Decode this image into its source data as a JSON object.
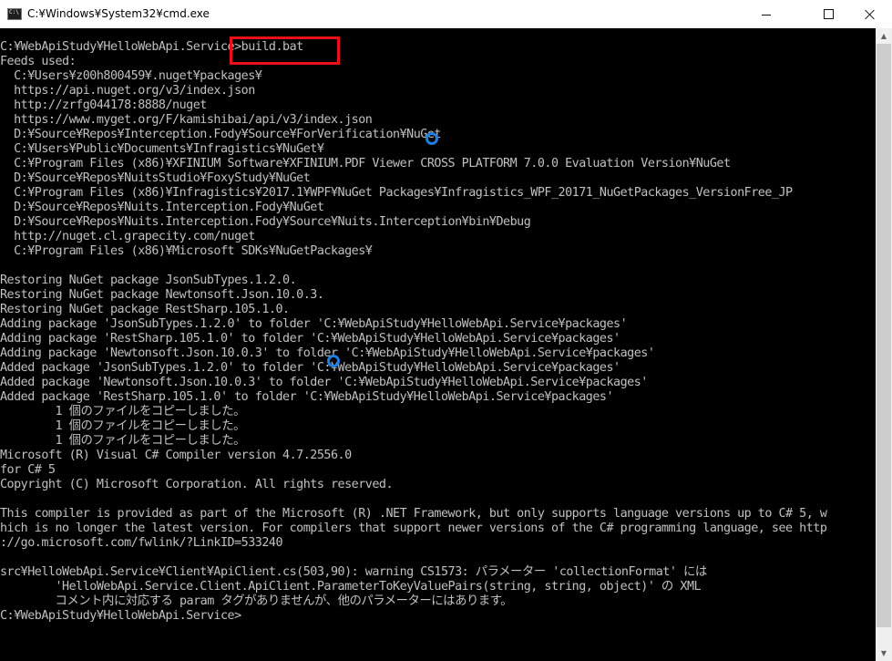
{
  "window": {
    "title": "C:¥Windows¥System32¥cmd.exe",
    "icons": {
      "app": "cmd-icon",
      "minimize": "minimize-icon",
      "maximize": "maximize-icon",
      "close": "close-icon",
      "scroll_up": "scroll-up-arrow-icon",
      "scroll_down": "scroll-down-arrow-icon"
    }
  },
  "console": {
    "lines": [
      "C:¥WebApiStudy¥HelloWebApi.Service>build.bat",
      "Feeds used:",
      "  C:¥Users¥z00h800459¥.nuget¥packages¥",
      "  https://api.nuget.org/v3/index.json",
      "  http://zrfg044178:8888/nuget",
      "  https://www.myget.org/F/kamishibai/api/v3/index.json",
      "  D:¥Source¥Repos¥Interception.Fody¥Source¥ForVerification¥NuGet",
      "  C:¥Users¥Public¥Documents¥Infragistics¥NuGet¥",
      "  C:¥Program Files (x86)¥XFINIUM Software¥XFINIUM.PDF Viewer CROSS PLATFORM 7.0.0 Evaluation Version¥NuGet",
      "  D:¥Source¥Repos¥NuitsStudio¥FoxyStudy¥NuGet",
      "  C:¥Program Files (x86)¥Infragistics¥2017.1¥WPF¥NuGet Packages¥Infragistics_WPF_20171_NuGetPackages_VersionFree_JP",
      "  D:¥Source¥Repos¥Nuits.Interception.Fody¥NuGet",
      "  D:¥Source¥Repos¥Nuits.Interception.Fody¥Source¥Nuits.Interception¥bin¥Debug",
      "  http://nuget.cl.grapecity.com/nuget",
      "  C:¥Program Files (x86)¥Microsoft SDKs¥NuGetPackages¥",
      "",
      "Restoring NuGet package JsonSubTypes.1.2.0.",
      "Restoring NuGet package Newtonsoft.Json.10.0.3.",
      "Restoring NuGet package RestSharp.105.1.0.",
      "Adding package 'JsonSubTypes.1.2.0' to folder 'C:¥WebApiStudy¥HelloWebApi.Service¥packages'",
      "Adding package 'RestSharp.105.1.0' to folder 'C:¥WebApiStudy¥HelloWebApi.Service¥packages'",
      "Adding package 'Newtonsoft.Json.10.0.3' to folder 'C:¥WebApiStudy¥HelloWebApi.Service¥packages'",
      "Added package 'JsonSubTypes.1.2.0' to folder 'C:¥WebApiStudy¥HelloWebApi.Service¥packages'",
      "Added package 'Newtonsoft.Json.10.0.3' to folder 'C:¥WebApiStudy¥HelloWebApi.Service¥packages'",
      "Added package 'RestSharp.105.1.0' to folder 'C:¥WebApiStudy¥HelloWebApi.Service¥packages'",
      "        1 個のファイルをコピーしました。",
      "        1 個のファイルをコピーしました。",
      "        1 個のファイルをコピーしました。",
      "Microsoft (R) Visual C# Compiler version 4.7.2556.0",
      "for C# 5",
      "Copyright (C) Microsoft Corporation. All rights reserved.",
      "",
      "This compiler is provided as part of the Microsoft (R) .NET Framework, but only supports language versions up to C# 5, w",
      "hich is no longer the latest version. For compilers that support newer versions of the C# programming language, see http",
      "://go.microsoft.com/fwlink/?LinkID=533240",
      "",
      "src¥HelloWebApi.Service¥Client¥ApiClient.cs(503,90): warning CS1573: パラメーター 'collectionFormat' には",
      "        'HelloWebApi.Service.Client.ApiClient.ParameterToKeyValuePairs(string, string, object)' の XML",
      "        コメント内に対応する param タグがありませんが、他のパラメーターにはあります。",
      "C:¥WebApiStudy¥HelloWebApi.Service>"
    ]
  },
  "colors": {
    "console_bg": "#000000",
    "console_text": "#c0c0c0",
    "highlight_border": "#e8101a",
    "click_marker": "#1e7fe0"
  }
}
